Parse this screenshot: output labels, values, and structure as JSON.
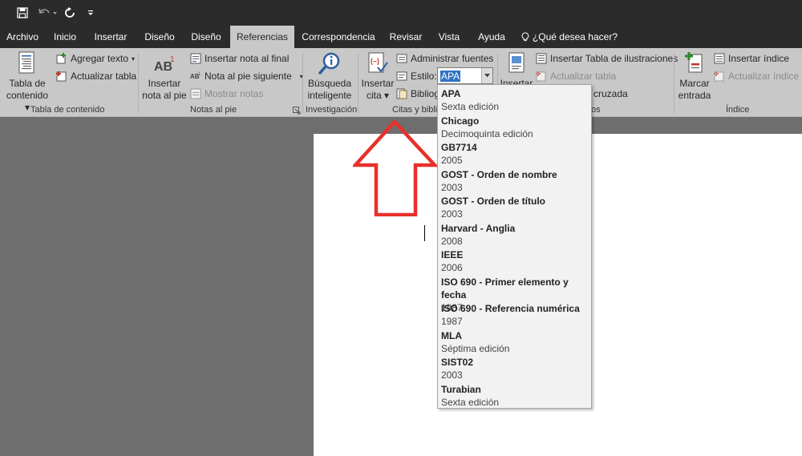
{
  "tabs": [
    "Archivo",
    "Inicio",
    "Insertar",
    "Diseño",
    "Diseño",
    "Referencias",
    "Correspondencia",
    "Revisar",
    "Vista",
    "Ayuda"
  ],
  "tell_me": "¿Qué desea hacer?",
  "groups": {
    "toc": {
      "label": "Tabla de contenido",
      "toc_button": [
        "Tabla de",
        "contenido"
      ],
      "add_text": "Agregar texto",
      "update_table": "Actualizar tabla"
    },
    "footnotes": {
      "label": "Notas al pie",
      "insert_footnote": [
        "Insertar",
        "nota al pie"
      ],
      "insert_endnote": "Insertar nota al final",
      "next_footnote": "Nota al pie siguiente",
      "show_notes": "Mostrar notas"
    },
    "research": {
      "label": "Investigación",
      "smart_lookup": [
        "Búsqueda",
        "inteligente"
      ]
    },
    "citations": {
      "label": "Citas y biblio",
      "insert_citation": [
        "Insertar",
        "cita"
      ],
      "manage_sources": "Administrar fuentes",
      "style_label": "Estilo:",
      "style_value": "APA",
      "bibliography": "Bibliog"
    },
    "captions": {
      "label": "os",
      "insert_caption": "Insertar",
      "insert_table_figures": "Insertar Tabla de ilustraciones",
      "update_table": "Actualizar tabla",
      "cross_reference": "cruzada"
    },
    "index": {
      "label": "Índice",
      "mark_entry": [
        "Marcar",
        "entrada"
      ],
      "insert_index": "Insertar índice",
      "update_index": "Actualizar índice"
    }
  },
  "styles": [
    {
      "name": "APA",
      "edition": "Sexta edición"
    },
    {
      "name": "Chicago",
      "edition": "Decimoquinta edición"
    },
    {
      "name": "GB7714",
      "edition": "2005"
    },
    {
      "name": "GOST - Orden de nombre",
      "edition": "2003"
    },
    {
      "name": "GOST - Orden de título",
      "edition": "2003"
    },
    {
      "name": "Harvard - Anglia",
      "edition": "2008"
    },
    {
      "name": "IEEE",
      "edition": "2006"
    },
    {
      "name": "ISO 690 - Primer elemento y fecha",
      "edition": "1987"
    },
    {
      "name": "ISO 690 - Referencia numérica",
      "edition": "1987"
    },
    {
      "name": "MLA",
      "edition": "Séptima edición"
    },
    {
      "name": "SIST02",
      "edition": "2003"
    },
    {
      "name": "Turabian",
      "edition": "Sexta edición"
    }
  ],
  "colors": {
    "titlebar": "#2b2b2b",
    "ribbon": "#c8c8c8",
    "selection": "#2f73c4",
    "annotation_arrow": "#e8302a"
  },
  "icons": [
    "save-icon",
    "undo-icon",
    "redo-icon",
    "customize-icon",
    "lightbulb-icon"
  ]
}
